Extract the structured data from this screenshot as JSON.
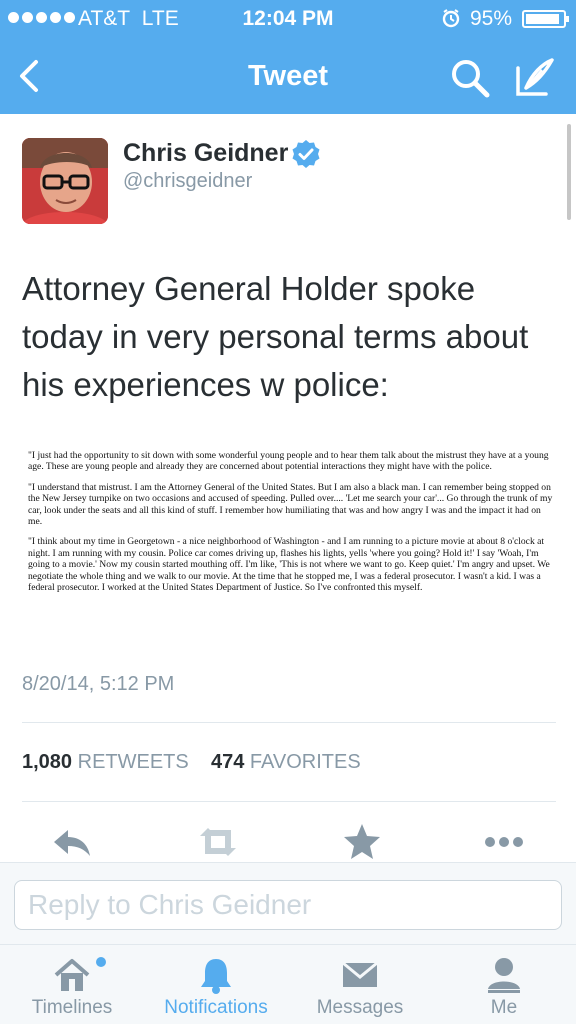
{
  "status_bar": {
    "carrier": "AT&T",
    "network": "LTE",
    "time": "12:04 PM",
    "battery": "95%"
  },
  "nav": {
    "title": "Tweet"
  },
  "tweet": {
    "author_name": "Chris Geidner",
    "author_handle": "@chrisgeidner",
    "text": "Attorney General Holder spoke today in very personal terms about his experiences w police:",
    "image_paragraphs": [
      "\"I just had the opportunity to sit down with some wonderful young people and to hear them talk about the mistrust they have at a young age. These are young people and already they are concerned about potential interactions they might have with the police.",
      "\"I understand that mistrust. I am the Attorney General of the United States. But I am also a black man. I can remember being stopped on the New Jersey turnpike on two occasions and accused of speeding. Pulled over.... 'Let me search your car'... Go through the trunk of my car, look under the seats and all this kind of stuff. I remember how humiliating that was and how angry I was and the impact it had on me.",
      "\"I think about my time in Georgetown - a nice neighborhood of Washington - and I am running to a picture movie at about 8 o'clock at night. I am running with my cousin. Police car comes driving up, flashes his lights, yells 'where you going? Hold it!' I say 'Woah, I'm going to a movie.' Now my cousin started mouthing off. I'm like, 'This is not where we want to go. Keep quiet.' I'm angry and upset. We negotiate the whole thing and we walk to our movie. At the time that he stopped me, I was a federal prosecutor. I wasn't a kid. I was a federal prosecutor. I worked at the United States Department of Justice. So I've confronted this myself."
    ],
    "timestamp": "8/20/14, 5:12 PM",
    "retweets_count": "1,080",
    "retweets_label": "RETWEETS",
    "favorites_count": "474",
    "favorites_label": "FAVORITES"
  },
  "reply": {
    "placeholder": "Reply to Chris Geidner"
  },
  "tabs": [
    {
      "label": "Timelines",
      "icon": "home-icon"
    },
    {
      "label": "Notifications",
      "icon": "bell-icon"
    },
    {
      "label": "Messages",
      "icon": "envelope-icon"
    },
    {
      "label": "Me",
      "icon": "person-icon"
    }
  ],
  "colors": {
    "brand": "#55acee",
    "secondary_text": "#8899a6",
    "verified": "#55acee"
  }
}
